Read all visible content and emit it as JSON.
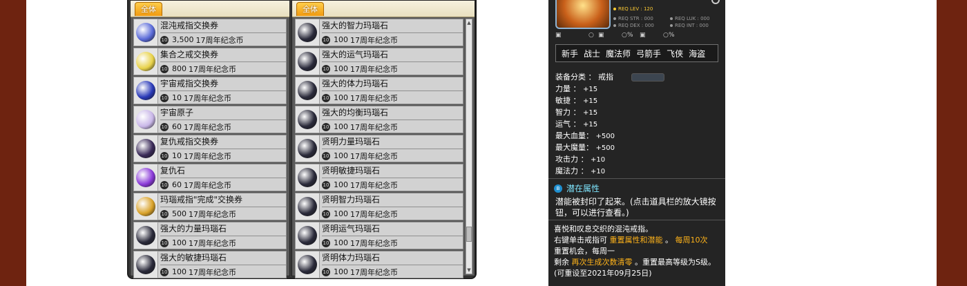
{
  "shop": {
    "left_tab": "全体",
    "right_tab": "全体",
    "left_items": [
      {
        "name": "混沌戒指交换券",
        "price": "3,500",
        "currency": "17周年纪念币",
        "icon": "ring-voucher-icon",
        "color": "#5a6ad8"
      },
      {
        "name": "集合之戒交换券",
        "price": "800",
        "currency": "17周年纪念币",
        "icon": "ring-voucher-icon",
        "color": "#e8d24a"
      },
      {
        "name": "宇宙戒指交换券",
        "price": "10",
        "currency": "17周年纪念币",
        "icon": "ring-voucher-icon",
        "color": "#2a3ab8"
      },
      {
        "name": "宇宙原子",
        "price": "60",
        "currency": "17周年纪念币",
        "icon": "atom-icon",
        "color": "#c9b7e8"
      },
      {
        "name": "复仇戒指交换券",
        "price": "10",
        "currency": "17周年纪念币",
        "icon": "ring-voucher-icon",
        "color": "#3a2a58"
      },
      {
        "name": "复仇石",
        "price": "60",
        "currency": "17周年纪念币",
        "icon": "purple-gem-icon",
        "color": "#8a3ad8"
      },
      {
        "name": "玛瑙戒指\"完成\"交换券",
        "price": "500",
        "currency": "17周年纪念币",
        "icon": "ring-voucher-icon",
        "color": "#d9a22a"
      },
      {
        "name": "强大的力量玛瑙石",
        "price": "100",
        "currency": "17周年纪念币",
        "icon": "agate-stone-icon",
        "color": "#2a2a3a"
      },
      {
        "name": "强大的敏捷玛瑙石",
        "price": "100",
        "currency": "17周年纪念币",
        "icon": "agate-stone-icon",
        "color": "#2a2a3a"
      }
    ],
    "right_items": [
      {
        "name": "强大的智力玛瑙石",
        "price": "100",
        "currency": "17周年纪念币",
        "icon": "agate-stone-icon",
        "color": "#2a2a3a"
      },
      {
        "name": "强大的运气玛瑙石",
        "price": "100",
        "currency": "17周年纪念币",
        "icon": "agate-stone-icon",
        "color": "#2a2a3a"
      },
      {
        "name": "强大的体力玛瑙石",
        "price": "100",
        "currency": "17周年纪念币",
        "icon": "agate-stone-icon",
        "color": "#2a2a3a"
      },
      {
        "name": "强大的均衡玛瑙石",
        "price": "100",
        "currency": "17周年纪念币",
        "icon": "agate-stone-icon",
        "color": "#2a2a3a"
      },
      {
        "name": "贤明力量玛瑙石",
        "price": "100",
        "currency": "17周年纪念币",
        "icon": "agate-stone-icon",
        "color": "#2a2a3a"
      },
      {
        "name": "贤明敏捷玛瑙石",
        "price": "100",
        "currency": "17周年纪念币",
        "icon": "agate-stone-icon",
        "color": "#2a2a3a"
      },
      {
        "name": "贤明智力玛瑙石",
        "price": "100",
        "currency": "17周年纪念币",
        "icon": "agate-stone-icon",
        "color": "#2a2a3a"
      },
      {
        "name": "贤明运气玛瑙石",
        "price": "100",
        "currency": "17周年纪念币",
        "icon": "agate-stone-icon",
        "color": "#2a2a3a"
      },
      {
        "name": "贤明体力玛瑙石",
        "price": "100",
        "currency": "17周年纪念币",
        "icon": "agate-stone-icon",
        "color": "#2a2a3a"
      }
    ]
  },
  "tooltip": {
    "req_lev": "REQ LEV : 120",
    "req_str": "REQ STR : 000",
    "req_dex": "REQ DEX : 000",
    "req_luk": "REQ LUK : 000",
    "req_int": "REQ INT : 000",
    "stat_icons": [
      "%",
      "%",
      "%"
    ],
    "jobs": [
      "新手",
      "战士",
      "魔法师",
      "弓箭手",
      "飞侠",
      "海盗"
    ],
    "stats": [
      {
        "label": "装备分类 ： 戒指",
        "value": ""
      },
      {
        "label": "力量 ：",
        "value": "+15"
      },
      {
        "label": "敏捷 ：",
        "value": "+15"
      },
      {
        "label": "智力 ：",
        "value": "+15"
      },
      {
        "label": "运气 ：",
        "value": "+15"
      },
      {
        "label": "最大血量：",
        "value": "+500"
      },
      {
        "label": "最大魔量：",
        "value": "+500"
      },
      {
        "label": "攻击力 ：",
        "value": "+10"
      },
      {
        "label": "魔法力 ：",
        "value": "+10"
      }
    ],
    "potential_icon": "B",
    "potential_title": "潜在属性",
    "potential_desc": "潜能被封印了起来。(点击道具栏的放大镜按钮，可以进行查看。)",
    "desc_1": "喜悦和叹息交织的混沌戒指。",
    "desc_2a": "右键单击戒指可 ",
    "desc_2b": "重置属性和潜能",
    "desc_2c": " 。 ",
    "desc_2d": "每周10次",
    "desc_3": " 重置机会，每周一",
    "desc_4a": "剩余 ",
    "desc_4b": "再次生成次数清零",
    "desc_4c": " 。重置最高等级为S级。",
    "desc_5": "(可重设至2021年09月25日)"
  },
  "coin_glyph": "10"
}
